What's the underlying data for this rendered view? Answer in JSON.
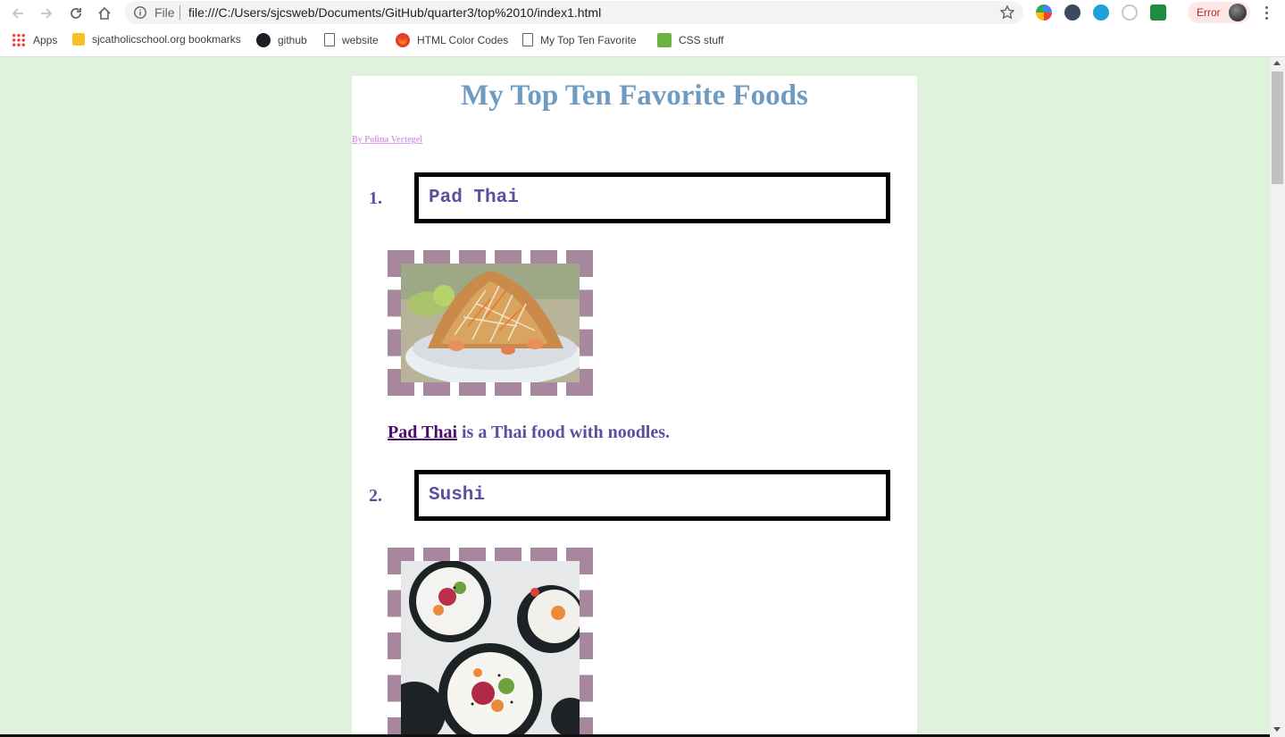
{
  "browser": {
    "url_scheme_label": "File",
    "url": "file:///C:/Users/sjcsweb/Documents/GitHub/quarter3/top%2010/index1.html",
    "profile_status": "Error",
    "icons": {
      "back": "back-arrow-icon",
      "forward": "forward-arrow-icon",
      "reload": "reload-icon",
      "home": "home-icon",
      "info": "info-icon",
      "star": "star-icon",
      "menu": "more-vert-icon"
    }
  },
  "bookmarks": [
    {
      "label": "Apps",
      "icon": "apps-grid-icon"
    },
    {
      "label": "sjcatholicschool.org bookmarks",
      "icon": "folder-icon"
    },
    {
      "label": "github",
      "icon": "github-icon"
    },
    {
      "label": "website",
      "icon": "page-icon"
    },
    {
      "label": "HTML Color Codes",
      "icon": "color-wheel-icon"
    },
    {
      "label": "My Top Ten Favorite F",
      "icon": "page-icon"
    },
    {
      "label": "CSS stuff",
      "icon": "css3-icon"
    }
  ],
  "page": {
    "title": "My Top Ten Favorite Foods",
    "byline": "By Polina Vertegel",
    "items": [
      {
        "number": "1.",
        "name": "Pad Thai",
        "link": "Pad Thai",
        "description": " is a Thai food with noodles."
      },
      {
        "number": "2.",
        "name": "Sushi"
      }
    ]
  },
  "colors": {
    "page_background": "#dff2db",
    "title": "#6f9bc0",
    "byline": "#d9a0e6",
    "item_text": "#5b4fa0",
    "link": "#4a0f6e",
    "image_border": "#a6879d"
  }
}
